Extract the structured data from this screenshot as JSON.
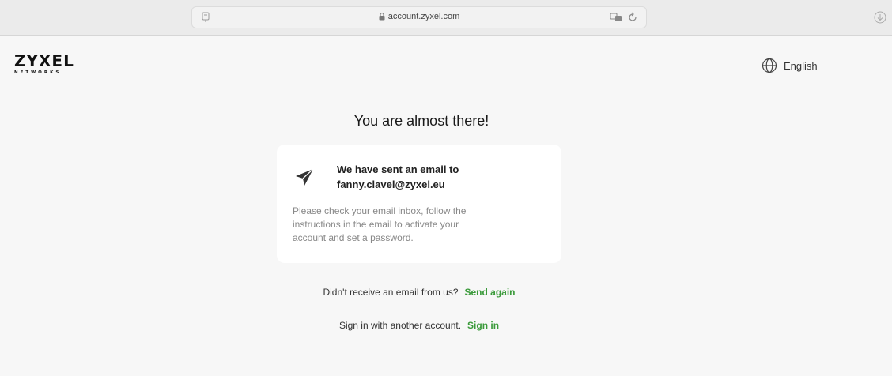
{
  "browser": {
    "url": "account.zyxel.com"
  },
  "header": {
    "logo_main": "ZYXEL",
    "logo_sub": "NETWORKS",
    "language": "English"
  },
  "main": {
    "title": "You are almost there!",
    "card": {
      "heading_line1": "We have sent an email to",
      "heading_line2": "fanny.clavel@zyxel.eu",
      "body_line1": "Please check your email inbox, follow the",
      "body_line2": "instructions in the email to activate your",
      "body_line3": "account and set a password."
    },
    "resend": {
      "text": "Didn't receive an email from us?",
      "link": "Send again"
    },
    "signin": {
      "text": "Sign in with another account.",
      "link": "Sign in"
    }
  },
  "colors": {
    "link_green": "#3a9a3a",
    "page_bg": "#f7f7f7",
    "card_bg": "#ffffff"
  },
  "icons": [
    "reader-icon",
    "lock-icon",
    "translate-icon",
    "reload-icon",
    "download-icon",
    "globe-icon",
    "paper-plane-icon"
  ]
}
